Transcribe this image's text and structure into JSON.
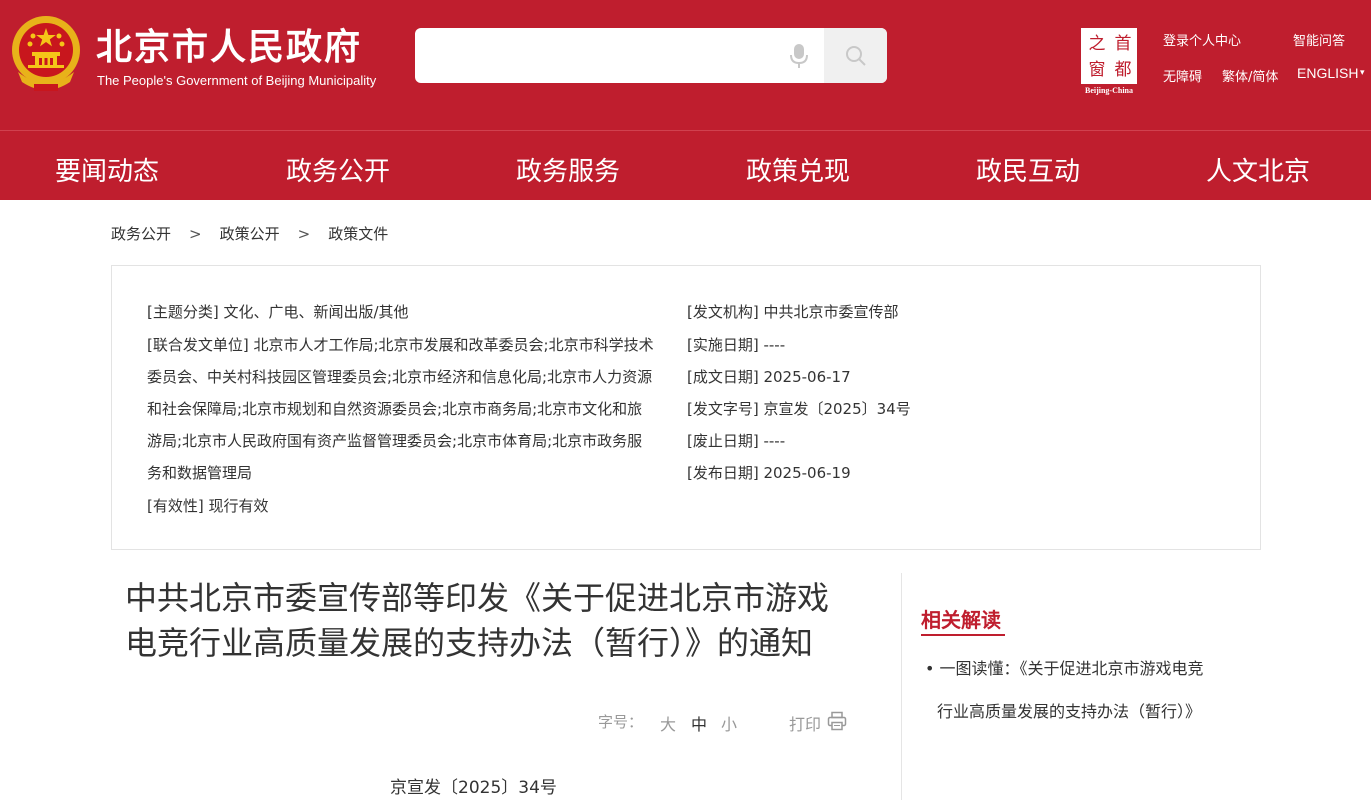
{
  "header": {
    "site_title": "北京市人民政府",
    "site_subtitle": "The People's Government of Beijing Municipality",
    "search": {
      "placeholder": ""
    },
    "capital_logo": {
      "chars": [
        "之",
        "首",
        "窗",
        "都"
      ],
      "caption": "Beijing-China"
    },
    "top_links": {
      "login": "登录个人中心",
      "smart_qa": "智能问答",
      "accessibility": "无障碍",
      "traditional": "繁体/简体",
      "english": "ENGLISH",
      "english_arrow": "▾"
    },
    "colors": {
      "brand_red": "#bf1e2e"
    }
  },
  "nav": {
    "items": [
      "要闻动态",
      "政务公开",
      "政务服务",
      "政策兑现",
      "政民互动",
      "人文北京"
    ]
  },
  "breadcrumb": {
    "items": [
      "政务公开",
      "政策公开",
      "政策文件"
    ],
    "separator": ">"
  },
  "info": {
    "topic": "[主题分类] 文化、广电、新闻出版/其他",
    "joint_lines": [
      "[联合发文单位] 北京市人才工作局;北京市发展和改革委员会;北京市科学技术",
      "委员会、中关村科技园区管理委员会;北京市经济和信息化局;北京市人力资源",
      "和社会保障局;北京市规划和自然资源委员会;北京市商务局;北京市文化和旅",
      "游局;北京市人民政府国有资产监督管理委员会;北京市体育局;北京市政务服",
      "务和数据管理局"
    ],
    "validity": "[有效性] 现行有效",
    "right": [
      "[发文机构] 中共北京市委宣传部",
      "[实施日期] ----",
      "[成文日期] 2025-06-17",
      "[发文字号] 京宣发〔2025〕34号",
      "[废止日期] ----",
      "[发布日期] 2025-06-19"
    ]
  },
  "article": {
    "title_line1": "中共北京市委宣传部等印发《关于促进北京市游戏",
    "title_line2": "电竞行业高质量发展的支持办法（暂行）》的通知",
    "font_size_label": "字号：",
    "font_sizes": [
      "大",
      "中",
      "小"
    ],
    "print_label": "打印",
    "doc_number": "京宣发〔2025〕34号"
  },
  "sidebar": {
    "related_title": "相关解读",
    "related_link_line1": "• 一图读懂：《关于促进北京市游戏电竞",
    "related_link_line2": "行业高质量发展的支持办法（暂行）》"
  }
}
